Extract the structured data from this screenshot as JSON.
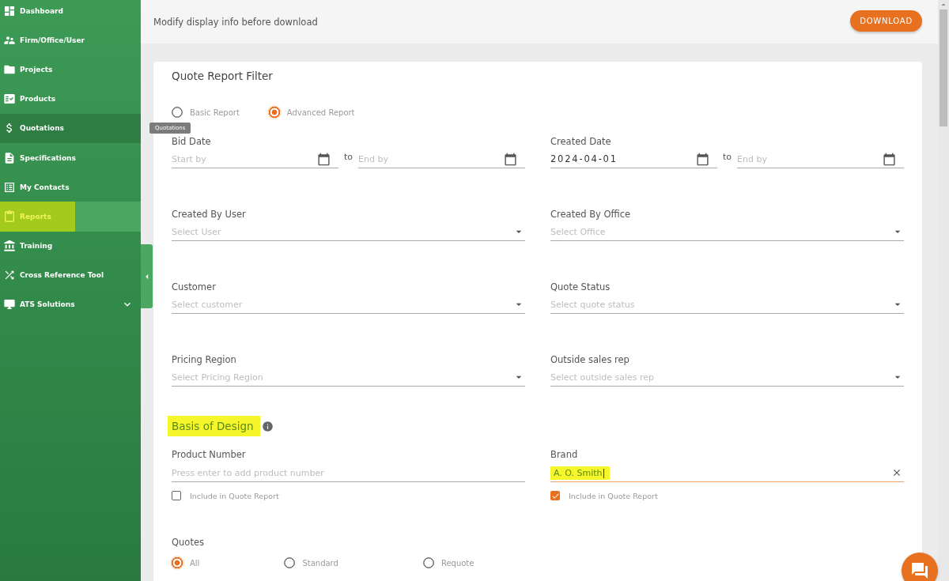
{
  "sidebar": {
    "items": [
      {
        "label": "Dashboard",
        "kind": "link",
        "selected": false,
        "hovered": false,
        "highlighted": false
      },
      {
        "label": "Firm/Office/User",
        "kind": "link",
        "selected": false,
        "hovered": false,
        "highlighted": false
      },
      {
        "label": "Projects",
        "kind": "link",
        "selected": false,
        "hovered": false,
        "highlighted": false
      },
      {
        "label": "Products",
        "kind": "link",
        "selected": false,
        "hovered": false,
        "highlighted": false
      },
      {
        "label": "Quotations",
        "kind": "link",
        "selected": false,
        "hovered": true,
        "highlighted": false
      },
      {
        "label": "Specifications",
        "kind": "link",
        "selected": false,
        "hovered": false,
        "highlighted": false
      },
      {
        "label": "My Contacts",
        "kind": "link",
        "selected": false,
        "hovered": false,
        "highlighted": false
      },
      {
        "label": "Reports",
        "kind": "link",
        "selected": true,
        "hovered": false,
        "highlighted": true
      },
      {
        "label": "Training",
        "kind": "link",
        "selected": false,
        "hovered": false,
        "highlighted": false
      },
      {
        "label": "Cross Reference Tool",
        "kind": "link",
        "selected": false,
        "hovered": false,
        "highlighted": false
      },
      {
        "label": "ATS Solutions",
        "kind": "group",
        "selected": false,
        "hovered": false,
        "highlighted": false
      }
    ],
    "tooltip": "Quotations"
  },
  "header": {
    "subtitle": "Modify display info before download",
    "download_button": "DOWNLOAD"
  },
  "filter": {
    "title": "Quote Report Filter",
    "report_types": [
      {
        "label": "Basic Report",
        "selected": false
      },
      {
        "label": "Advanced Report",
        "selected": true
      }
    ],
    "date_ranges": [
      {
        "label": "Bid Date",
        "start": {
          "placeholder": "Start by"
        },
        "separator": "to",
        "end": {
          "placeholder": "End by"
        }
      },
      {
        "label": "Created Date",
        "start": {
          "value": "2024-04-01"
        },
        "separator": "to",
        "end": {
          "placeholder": "End by"
        }
      }
    ],
    "selects": [
      {
        "label": "Created By User",
        "placeholder": "Select User"
      },
      {
        "label": "Created By Office",
        "placeholder": "Select Office"
      },
      {
        "label": "Customer",
        "placeholder": "Select customer"
      },
      {
        "label": "Quote Status",
        "placeholder": "Select quote status"
      },
      {
        "label": "Pricing Region",
        "placeholder": "Select Pricing Region"
      },
      {
        "label": "Outside sales rep",
        "placeholder": "Select outside sales rep"
      }
    ],
    "basis_of_design": {
      "title": "Basis of Design",
      "highlighted": true,
      "fields": [
        {
          "label": "Product Number",
          "placeholder": "Press enter to add product number",
          "focused": false,
          "value_highlighted": false,
          "include": {
            "label": "Include in Quote Report",
            "checked": false
          }
        },
        {
          "label": "Brand",
          "value": "A. O. Smith",
          "focused": true,
          "value_highlighted": true,
          "include": {
            "label": "Include in Quote Report",
            "checked": true
          }
        }
      ]
    },
    "quotes": {
      "label": "Quotes",
      "options": [
        {
          "label": "All",
          "selected": true
        },
        {
          "label": "Standard",
          "selected": false
        },
        {
          "label": "Requote",
          "selected": false
        }
      ]
    }
  }
}
